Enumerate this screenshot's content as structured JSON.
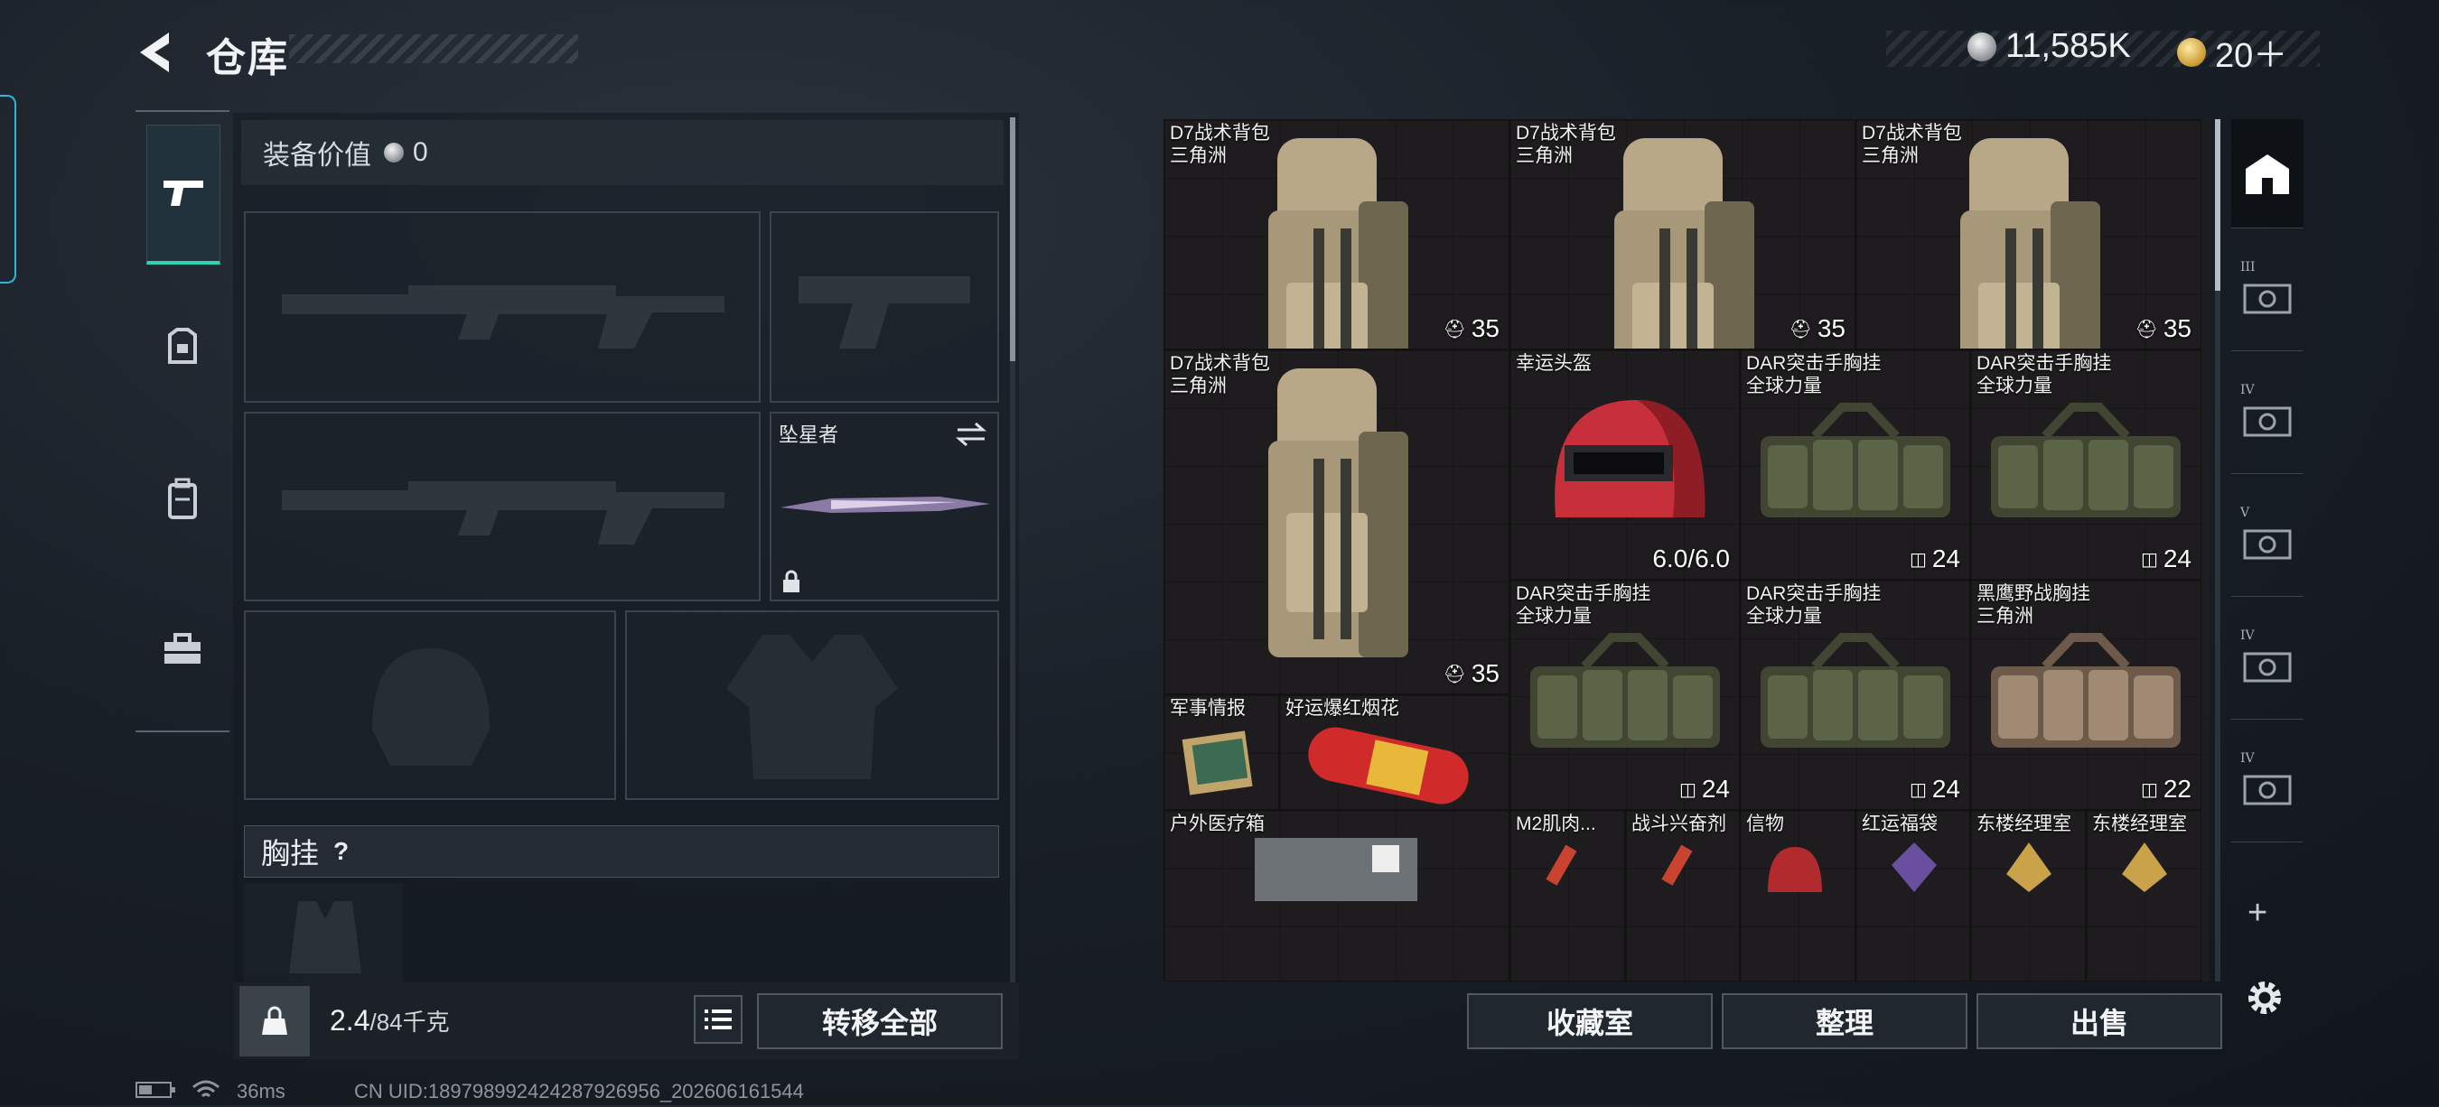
{
  "header": {
    "title": "仓库",
    "currency_silver": "11,585K",
    "currency_gold": "20＋"
  },
  "loadout": {
    "value_label": "装备价值",
    "value": "0",
    "knife_label": "坠星者",
    "chest_rig_label": "胸挂",
    "chest_rig_help": "?",
    "weight_value": "2.4",
    "weight_capacity": "/84千克",
    "transfer_all": "转移全部"
  },
  "stash": {
    "items": [
      {
        "name": "D7战术背包",
        "sub": "三角洲",
        "stat": "35",
        "stat_icon": "backpack-icon",
        "bg": "red",
        "kind": "backpack"
      },
      {
        "name": "D7战术背包",
        "sub": "三角洲",
        "stat": "35",
        "stat_icon": "backpack-icon",
        "bg": "red",
        "kind": "backpack"
      },
      {
        "name": "D7战术背包",
        "sub": "三角洲",
        "stat": "35",
        "stat_icon": "backpack-icon",
        "bg": "red",
        "kind": "backpack"
      },
      {
        "name": "D7战术背包",
        "sub": "三角洲",
        "stat": "35",
        "stat_icon": "backpack-icon",
        "bg": "red",
        "kind": "backpack"
      },
      {
        "name": "幸运头盔",
        "sub": "",
        "stat": "6.0/6.0",
        "stat_icon": "",
        "bg": "red",
        "kind": "helmet"
      },
      {
        "name": "DAR突击手胸挂",
        "sub": "全球力量",
        "stat": "24",
        "stat_icon": "vest-icon",
        "bg": "olive",
        "kind": "rig"
      },
      {
        "name": "DAR突击手胸挂",
        "sub": "全球力量",
        "stat": "24",
        "stat_icon": "vest-icon",
        "bg": "olive",
        "kind": "rig"
      },
      {
        "name": "DAR突击手胸挂",
        "sub": "全球力量",
        "stat": "24",
        "stat_icon": "vest-icon",
        "bg": "olive",
        "kind": "rig"
      },
      {
        "name": "DAR突击手胸挂",
        "sub": "全球力量",
        "stat": "24",
        "stat_icon": "vest-icon",
        "bg": "olive",
        "kind": "rig"
      },
      {
        "name": "黑鹰野战胸挂",
        "sub": "三角洲",
        "stat": "22",
        "stat_icon": "vest-icon",
        "bg": "olive",
        "kind": "rig-tan"
      },
      {
        "name": "军事情报",
        "sub": "",
        "stat": "",
        "stat_icon": "",
        "bg": "blue",
        "kind": "intel"
      },
      {
        "name": "好运爆红烟花",
        "sub": "",
        "stat": "",
        "stat_icon": "",
        "bg": "olive",
        "kind": "firework"
      },
      {
        "name": "户外医疗箱",
        "sub": "",
        "stat": "",
        "stat_icon": "",
        "bg": "blue",
        "kind": "medbox"
      },
      {
        "name": "M2肌肉...",
        "sub": "",
        "stat": "",
        "stat_icon": "",
        "bg": "blue",
        "kind": "syringe"
      },
      {
        "name": "战斗兴奋剂",
        "sub": "",
        "stat": "",
        "stat_icon": "",
        "bg": "blue",
        "kind": "syringe"
      },
      {
        "name": "信物",
        "sub": "",
        "stat": "",
        "stat_icon": "",
        "bg": "blue",
        "kind": "token"
      },
      {
        "name": "红运福袋",
        "sub": "",
        "stat": "",
        "stat_icon": "",
        "bg": "blue",
        "kind": "bag"
      },
      {
        "name": "东楼经理室",
        "sub": "",
        "stat": "",
        "stat_icon": "",
        "bg": "olive",
        "kind": "key"
      },
      {
        "name": "东楼经理室",
        "sub": "",
        "stat": "",
        "stat_icon": "",
        "bg": "olive",
        "kind": "key"
      }
    ],
    "buttons": {
      "collection": "收藏室",
      "sort": "整理",
      "sell": "出售"
    }
  },
  "right_tabs": [
    {
      "icon": "home-icon",
      "tier": ""
    },
    {
      "icon": "stash-case-icon",
      "tier": "III"
    },
    {
      "icon": "stash-case-icon",
      "tier": "IV"
    },
    {
      "icon": "stash-case-icon",
      "tier": "V"
    },
    {
      "icon": "stash-case-icon",
      "tier": "IV"
    },
    {
      "icon": "stash-case-icon",
      "tier": "IV"
    }
  ],
  "footer": {
    "ping": "36ms",
    "uid": "CN UID:18979899242428792​6956_202606161544"
  },
  "colors": {
    "accent": "#2fd3b3",
    "red_cell": "#5e262c",
    "olive_cell": "#42382f"
  }
}
